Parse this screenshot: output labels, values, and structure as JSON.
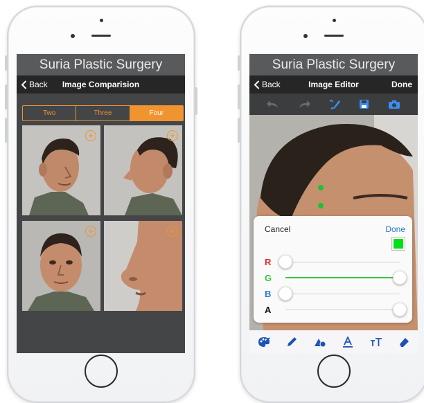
{
  "left_phone": {
    "app_title": "Suria Plastic Surgery",
    "nav": {
      "back_label": "Back",
      "title": "Image Comparision"
    },
    "segments": [
      {
        "label": "Two",
        "active": false
      },
      {
        "label": "Three",
        "active": false
      },
      {
        "label": "Four",
        "active": true
      }
    ],
    "tiles": [
      {
        "view": "three-quarter-left",
        "action_icon": "add-circle-icon"
      },
      {
        "view": "profile-right",
        "action_icon": "add-circle-icon"
      },
      {
        "view": "front",
        "action_icon": "add-circle-icon"
      },
      {
        "view": "nose-closeup",
        "action_icon": "add-circle-icon"
      }
    ]
  },
  "right_phone": {
    "app_title": "Suria Plastic Surgery",
    "nav": {
      "back_label": "Back",
      "title": "Image Editor",
      "done_label": "Done"
    },
    "toolbar_icons": [
      "undo-icon",
      "redo-icon",
      "brush-icon",
      "save-icon",
      "camera-icon"
    ],
    "color_panel": {
      "cancel_label": "Cancel",
      "done_label": "Done",
      "swatch_color": "#00e01a",
      "sliders": [
        {
          "label": "R",
          "value": 0,
          "color": "#e22b2b"
        },
        {
          "label": "G",
          "value": 255,
          "color": "#35c43a"
        },
        {
          "label": "B",
          "value": 0,
          "color": "#2a7ad8"
        },
        {
          "label": "A",
          "value": 255,
          "color": "#111111"
        }
      ]
    },
    "bottom_tools": [
      "palette-icon",
      "pencil-icon",
      "shapes-icon",
      "text-underline-icon",
      "text-size-icon",
      "eraser-icon"
    ]
  },
  "colors": {
    "accent": "#f0942f",
    "nav_bg": "#262626",
    "title_bg": "#595a5c",
    "tool_blue": "#1e53b6"
  }
}
